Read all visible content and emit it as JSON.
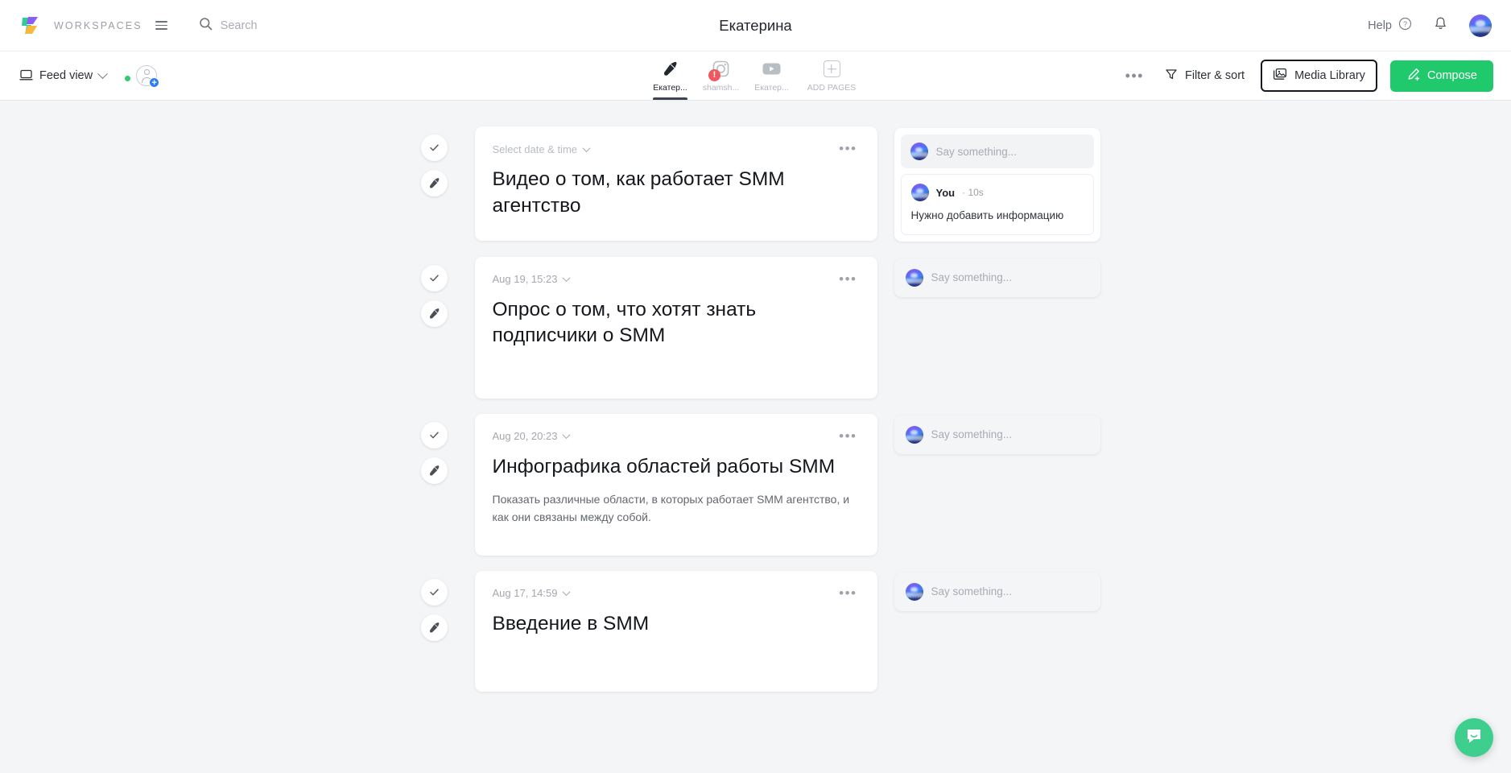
{
  "header": {
    "brand": "WORKSPACES",
    "search_placeholder": "Search",
    "workspace_title": "Екатерина",
    "help_label": "Help"
  },
  "toolbar": {
    "view_label": "Feed view",
    "filter_label": "Filter & sort",
    "media_library_label": "Media Library",
    "compose_label": "Compose",
    "more_label": "•••"
  },
  "page_tabs": [
    {
      "label": "Екатер...",
      "icon": "pen-icon",
      "active": true,
      "badge": ""
    },
    {
      "label": "shamsh...",
      "icon": "instagram-icon",
      "active": false,
      "badge": "!"
    },
    {
      "label": "Екатер...",
      "icon": "youtube-icon",
      "active": false,
      "badge": ""
    },
    {
      "label": "ADD PAGES",
      "icon": "plus-square-icon",
      "active": false,
      "badge": ""
    }
  ],
  "posts": [
    {
      "date": "Select date & time",
      "date_is_placeholder": true,
      "title": "Видео о том, как работает SMM агентство",
      "body": "",
      "menu": "•••",
      "comments": {
        "composer_placeholder": "Say something...",
        "items": [
          {
            "author": "You",
            "time": "10s",
            "text": "Нужно добавить информацию"
          }
        ]
      }
    },
    {
      "date": "Aug 19, 15:23",
      "date_is_placeholder": false,
      "title": "Опрос о том, что хотят знать подписчики о SMM",
      "body": "",
      "menu": "•••",
      "comments": {
        "composer_placeholder": "Say something...",
        "items": []
      }
    },
    {
      "date": "Aug 20, 20:23",
      "date_is_placeholder": false,
      "title": "Инфографика областей работы SMM",
      "body": "Показать различные области, в которых работает SMM агентство, и как они связаны между собой.",
      "menu": "•••",
      "comments": {
        "composer_placeholder": "Say something...",
        "items": []
      }
    },
    {
      "date": "Aug 17, 14:59",
      "date_is_placeholder": false,
      "title": "Введение в SMM",
      "body": "",
      "menu": "•••",
      "comments": {
        "composer_placeholder": "Say something...",
        "items": []
      }
    }
  ],
  "colors": {
    "accent_green": "#20c96b",
    "chat_green": "#3ecf8e",
    "error_red": "#f0575f",
    "page_bg": "#f4f5f7",
    "text_primary": "#14171c"
  }
}
